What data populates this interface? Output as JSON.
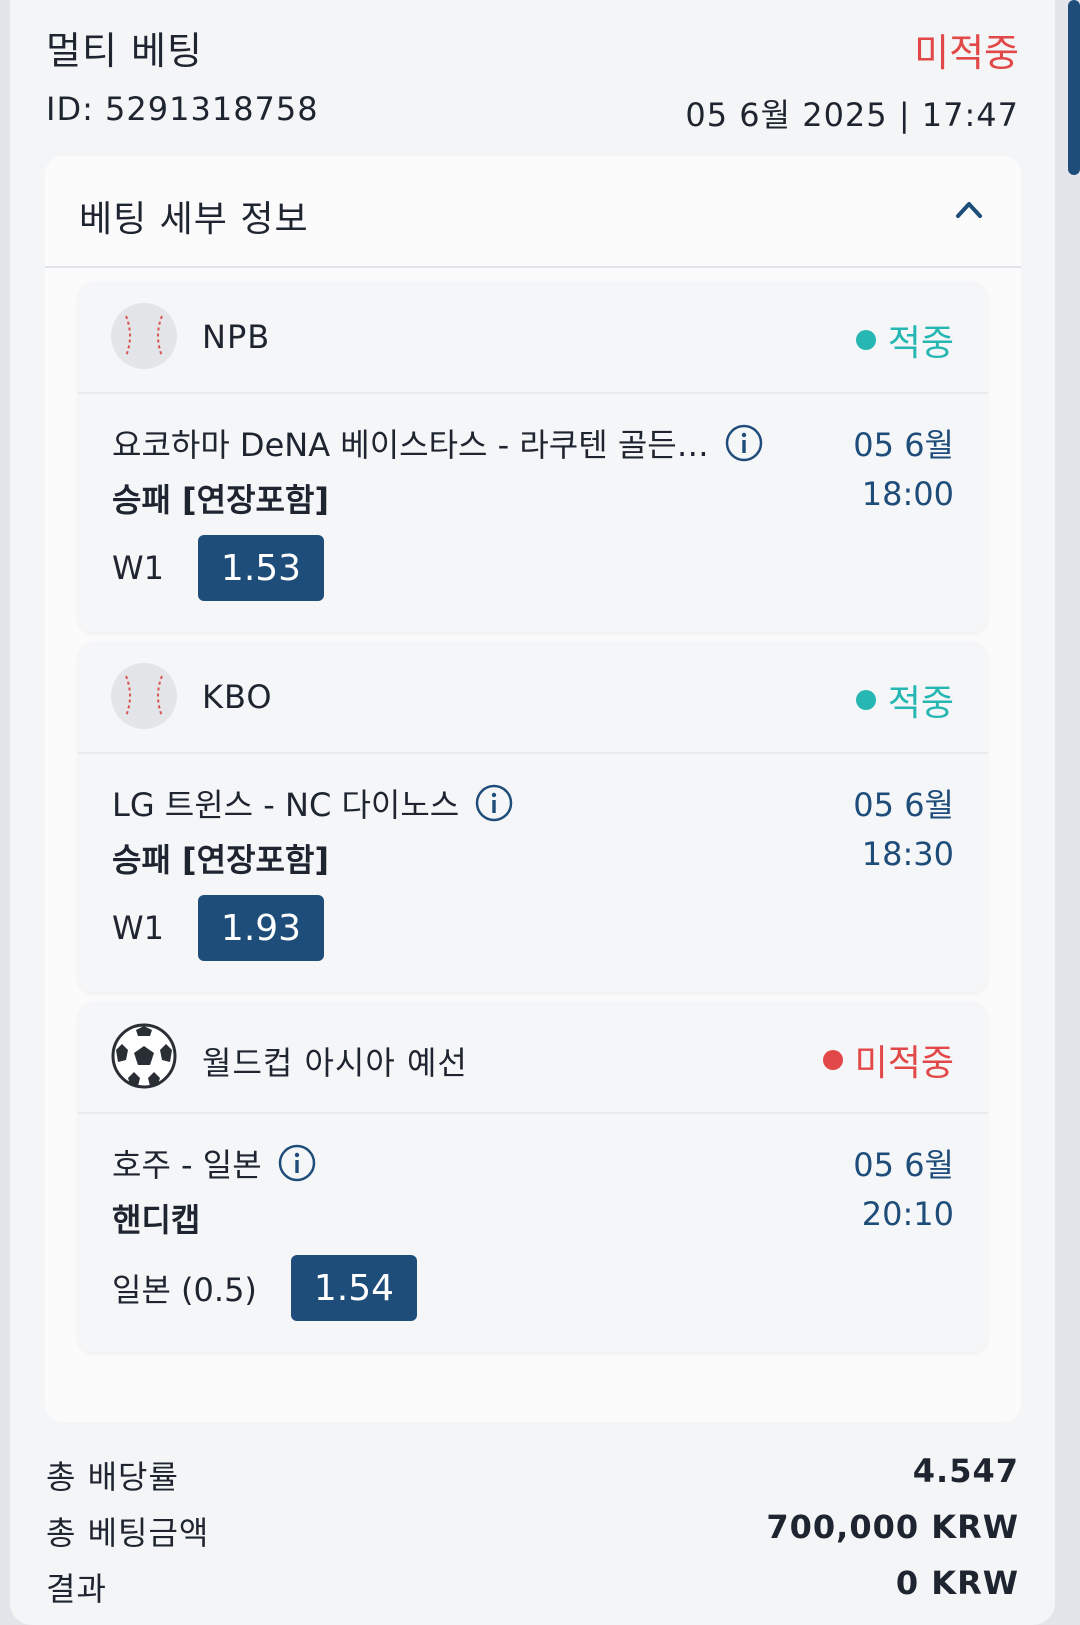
{
  "header": {
    "title": "멀티 베팅",
    "status": "미적중",
    "id_text": "ID: 5291318758",
    "datetime": "05 6월 2025 | 17:47"
  },
  "details": {
    "title": "베팅 세부 정보",
    "legs": [
      {
        "sport_icon": "baseball-icon",
        "league": "NPB",
        "status": "적중",
        "match": "요코하마 DeNA 베이스타스 - 라쿠텐 골든…",
        "market": "승패 [연장포함]",
        "pick": "W1",
        "odds": "1.53",
        "date": "05 6월",
        "time": "18:00"
      },
      {
        "sport_icon": "baseball-icon",
        "league": "KBO",
        "status": "적중",
        "match": "LG 트윈스 - NC 다이노스",
        "market": "승패 [연장포함]",
        "pick": "W1",
        "odds": "1.93",
        "date": "05 6월",
        "time": "18:30"
      },
      {
        "sport_icon": "soccer-ball-icon",
        "league": "월드컵 아시아 예선",
        "status": "미적중",
        "match": "호주 - 일본",
        "market": "핸디캡",
        "pick": "일본 (0.5)",
        "odds": "1.54",
        "date": "05 6월",
        "time": "20:10"
      }
    ]
  },
  "summary": {
    "total_odds_label": "총 배당률",
    "total_odds_value": "4.547",
    "total_stake_label": "총 베팅금액",
    "total_stake_value": "700,000 KRW",
    "result_label": "결과",
    "result_value": "0 KRW"
  },
  "colors": {
    "win": "#27b7b3",
    "lose": "#e24848",
    "accent": "#1f4d7a"
  }
}
